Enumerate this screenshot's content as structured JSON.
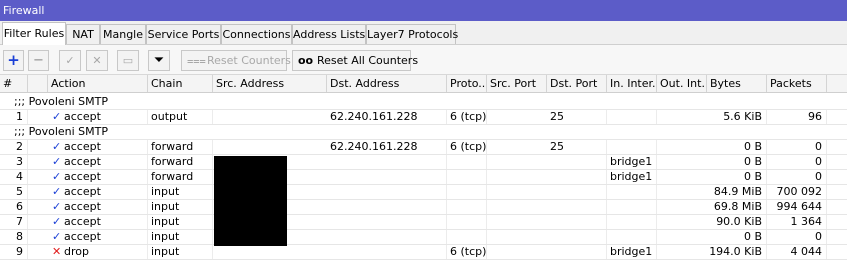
{
  "window": {
    "title": "Firewall"
  },
  "tabs": [
    {
      "label": "Filter Rules",
      "active": true
    },
    {
      "label": "NAT"
    },
    {
      "label": "Mangle"
    },
    {
      "label": "Service Ports"
    },
    {
      "label": "Connections"
    },
    {
      "label": "Address Lists"
    },
    {
      "label": "Layer7 Protocols"
    }
  ],
  "toolbar": {
    "add_icon": "+",
    "remove_icon": "−",
    "enable_icon": "✓",
    "disable_icon": "✕",
    "comment_icon": "▭",
    "filter_icon": "⏷",
    "reset_counters_icon": "⩶",
    "reset_counters_label": "Reset Counters",
    "reset_all_counters_icon": "oo",
    "reset_all_counters_label": "Reset All Counters"
  },
  "columns": [
    "#",
    "",
    "Action",
    "Chain",
    "Src. Address",
    "Dst. Address",
    "Proto...",
    "Src. Port",
    "Dst. Port",
    "In. Inter...",
    "Out. Int...",
    "Bytes",
    "Packets"
  ],
  "comments": {
    "smtp_1": ";;; Povoleni SMTP",
    "smtp_2": ";;; Povoleni SMTP"
  },
  "rules": [
    {
      "num": "1",
      "action": "accept",
      "chain": "output",
      "dst": "62.240.161.228",
      "proto": "6 (tcp)",
      "dport": "25",
      "in": "",
      "bytes": "5.6 KiB",
      "packets": "96"
    },
    {
      "num": "2",
      "action": "accept",
      "chain": "forward",
      "dst": "62.240.161.228",
      "proto": "6 (tcp)",
      "dport": "25",
      "in": "",
      "bytes": "0 B",
      "packets": "0"
    },
    {
      "num": "3",
      "action": "accept",
      "chain": "forward",
      "dst": "",
      "proto": "",
      "dport": "",
      "in": "bridge1",
      "bytes": "0 B",
      "packets": "0"
    },
    {
      "num": "4",
      "action": "accept",
      "chain": "forward",
      "dst": "",
      "proto": "",
      "dport": "",
      "in": "bridge1",
      "bytes": "0 B",
      "packets": "0"
    },
    {
      "num": "5",
      "action": "accept",
      "chain": "input",
      "dst": "",
      "proto": "",
      "dport": "",
      "in": "",
      "bytes": "84.9 MiB",
      "packets": "700 092"
    },
    {
      "num": "6",
      "action": "accept",
      "chain": "input",
      "dst": "",
      "proto": "",
      "dport": "",
      "in": "",
      "bytes": "69.8 MiB",
      "packets": "994 644"
    },
    {
      "num": "7",
      "action": "accept",
      "chain": "input",
      "dst": "",
      "proto": "",
      "dport": "",
      "in": "",
      "bytes": "90.0 KiB",
      "packets": "1 364"
    },
    {
      "num": "8",
      "action": "accept",
      "chain": "input",
      "dst": "",
      "proto": "",
      "dport": "",
      "in": "",
      "bytes": "0 B",
      "packets": "0"
    },
    {
      "num": "9",
      "action": "drop",
      "chain": "input",
      "dst": "",
      "proto": "6 (tcp)",
      "dport": "",
      "in": "bridge1",
      "bytes": "194.0 KiB",
      "packets": "4 044"
    }
  ],
  "icons": {
    "accept": "check-icon",
    "drop": "x-icon"
  },
  "colors": {
    "titlebar": "#5c5cc8",
    "accept": "#1a3fd6",
    "drop": "#e01b1b",
    "add": "#1a3fd6"
  }
}
